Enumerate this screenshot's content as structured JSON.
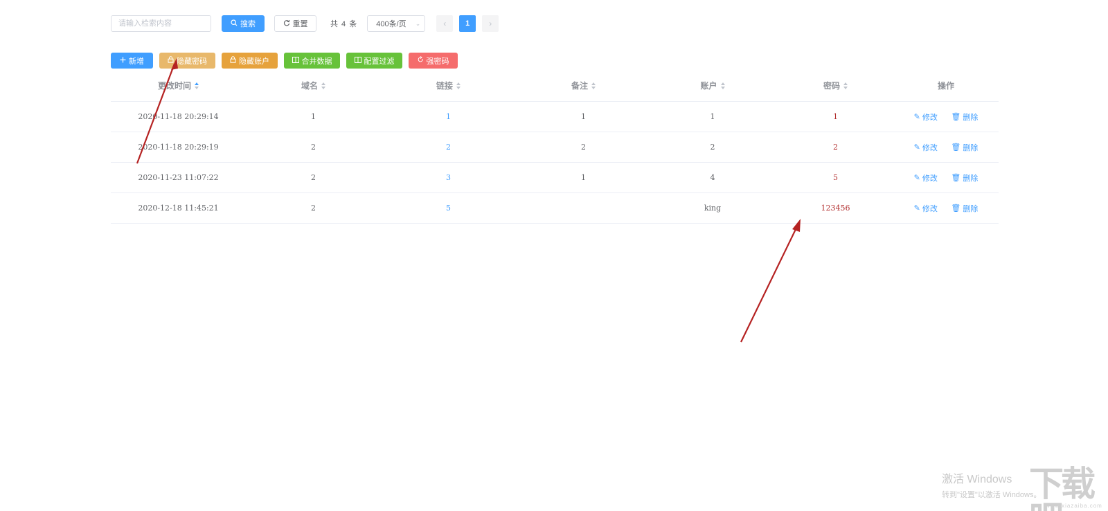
{
  "search": {
    "placeholder": "请输入检索内容",
    "search_label": "搜索",
    "reset_label": "重置"
  },
  "pagination": {
    "total_text": "共 4 条",
    "page_size": "400条/页",
    "current_page": "1",
    "prev": "‹",
    "next": "›"
  },
  "actions": [
    {
      "label": "新增",
      "icon": "plus-icon"
    },
    {
      "label": "隐藏密码",
      "icon": "lock-icon"
    },
    {
      "label": "隐藏账户",
      "icon": "lock-icon"
    },
    {
      "label": "合并数据",
      "icon": "columns-icon"
    },
    {
      "label": "配置过滤",
      "icon": "columns-icon"
    },
    {
      "label": "强密码",
      "icon": "refresh-icon"
    }
  ],
  "table": {
    "headers": [
      "更改时间",
      "域名",
      "链接",
      "备注",
      "账户",
      "密码",
      "操作"
    ],
    "sorted_column": "更改时间",
    "rows": [
      {
        "time": "2020-11-18 20:29:14",
        "domain": "1",
        "link": "1",
        "note": "1",
        "account": "1",
        "password": "1"
      },
      {
        "time": "2020-11-18 20:29:19",
        "domain": "2",
        "link": "2",
        "note": "2",
        "account": "2",
        "password": "2"
      },
      {
        "time": "2020-11-23 11:07:22",
        "domain": "2",
        "link": "3",
        "note": "1",
        "account": "4",
        "password": "5"
      },
      {
        "time": "2020-12-18 11:45:21",
        "domain": "2",
        "link": "5",
        "note": "",
        "account": "king",
        "password": "123456"
      }
    ],
    "edit_label": "修改",
    "delete_label": "删除"
  },
  "watermark": {
    "title": "激活 Windows",
    "subtitle": "转到\"设置\"以激活 Windows。",
    "logo": "下载吧",
    "logo_url": "www.xiazaiba.com"
  },
  "colors": {
    "primary": "#409eff",
    "warning": "#e6a23c",
    "success": "#67c23a",
    "danger": "#f56c6c",
    "password_text": "#b22f2f",
    "annotation_arrow": "#b52222"
  }
}
